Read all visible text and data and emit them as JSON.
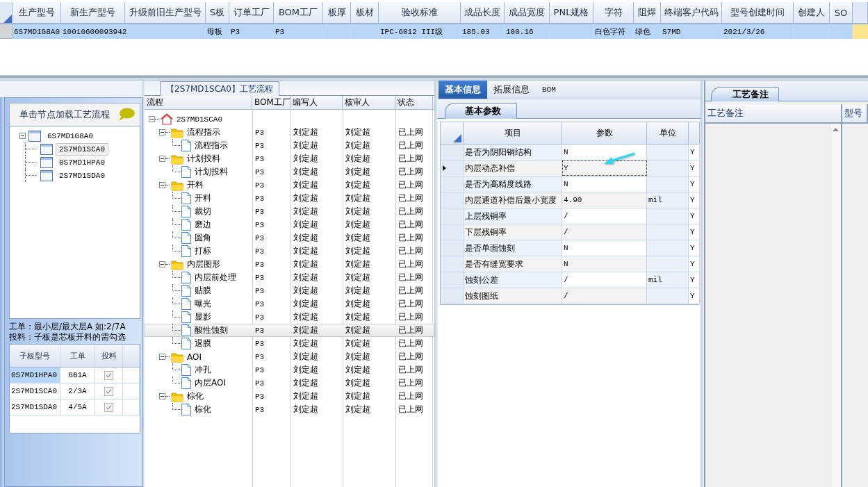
{
  "main_grid": {
    "row_selected": true,
    "columns": [
      {
        "header": "生产型号",
        "value": "6S7MD1G8A0"
      },
      {
        "header": "新生产型号",
        "value": "10010600093942"
      },
      {
        "header": "升级前旧生产型号"
      },
      {
        "header": "S板",
        "value": "母板"
      },
      {
        "header": "订单工厂",
        "value": "P3"
      },
      {
        "header": "BOM工厂",
        "value": "P3"
      },
      {
        "header": "板厚"
      },
      {
        "header": "板材"
      },
      {
        "header": "验收标准",
        "value": "IPC-6012 III级"
      },
      {
        "header": "成品长度",
        "value": "185.03"
      },
      {
        "header": "成品宽度",
        "value": "100.16"
      },
      {
        "header": "PNL规格"
      },
      {
        "header": "字符",
        "value": "白色字符"
      },
      {
        "header": "阻焊",
        "value": "绿色"
      },
      {
        "header": "终端客户代码",
        "value": "S7MD"
      },
      {
        "header": "型号创建时间",
        "value": "2021/3/26"
      },
      {
        "header": "创建人"
      },
      {
        "header": "SO"
      }
    ]
  },
  "left_panel": {
    "header": "单击节点加载工艺流程",
    "tree": [
      {
        "label": "6S7MD1G8A0",
        "expanded": true,
        "selected": false,
        "children": [
          {
            "label": "2S7MD1SCA0",
            "selected": true
          },
          {
            "label": "0S7MD1HPA0",
            "selected": false
          },
          {
            "label": "2S7MD1SDA0",
            "selected": false
          }
        ]
      }
    ],
    "notes": [
      "工单：最小层/最大层A 如:2/7A",
      "投料：子板是芯板开料的需勾选"
    ],
    "sub_grid": {
      "columns": [
        "子板型号",
        "工单",
        "投料"
      ],
      "rows": [
        {
          "model": "0S7MD1HPA0",
          "order": "GB1A",
          "feed": true,
          "selected": true
        },
        {
          "model": "2S7MD1SCA0",
          "order": "2/3A",
          "feed": true,
          "selected": false
        },
        {
          "model": "2S7MD1SDA0",
          "order": "4/5A",
          "feed": true,
          "selected": false
        }
      ]
    }
  },
  "process": {
    "title": "【2S7MD1SCA0】工艺流程",
    "columns": [
      "流程",
      "BOM工厂",
      "编写人",
      "核审人",
      "状态"
    ],
    "tree": {
      "label": "2S7MD1SCA0",
      "kind": "root",
      "expanded": true,
      "selected": false,
      "children": [
        {
          "label": "流程指示",
          "kind": "folder",
          "expanded": true,
          "selected": false,
          "factory": "P3",
          "writer": "刘定超",
          "reviewer": "刘定超",
          "status": "已上网",
          "children": [
            {
              "label": "流程指示",
              "kind": "step",
              "selected": false,
              "factory": "P3",
              "writer": "刘定超",
              "reviewer": "刘定超",
              "status": "已上网"
            }
          ]
        },
        {
          "label": "计划投料",
          "kind": "folder",
          "expanded": true,
          "selected": false,
          "factory": "P3",
          "writer": "刘定超",
          "reviewer": "刘定超",
          "status": "已上网",
          "children": [
            {
              "label": "计划投料",
              "kind": "step",
              "selected": false,
              "factory": "P3",
              "writer": "刘定超",
              "reviewer": "刘定超",
              "status": "已上网"
            }
          ]
        },
        {
          "label": "开料",
          "kind": "folder",
          "expanded": true,
          "selected": false,
          "factory": "P3",
          "writer": "刘定超",
          "reviewer": "刘定超",
          "status": "已上网",
          "children": [
            {
              "label": "开料",
              "kind": "step",
              "selected": false,
              "factory": "P3",
              "writer": "刘定超",
              "reviewer": "刘定超",
              "status": "已上网"
            },
            {
              "label": "裁切",
              "kind": "step",
              "selected": false,
              "factory": "P3",
              "writer": "刘定超",
              "reviewer": "刘定超",
              "status": "已上网"
            },
            {
              "label": "磨边",
              "kind": "step",
              "selected": false,
              "factory": "P3",
              "writer": "刘定超",
              "reviewer": "刘定超",
              "status": "已上网"
            },
            {
              "label": "圆角",
              "kind": "step",
              "selected": false,
              "factory": "P3",
              "writer": "刘定超",
              "reviewer": "刘定超",
              "status": "已上网"
            },
            {
              "label": "打标",
              "kind": "step",
              "selected": false,
              "factory": "P3",
              "writer": "刘定超",
              "reviewer": "刘定超",
              "status": "已上网"
            }
          ]
        },
        {
          "label": "内层图形",
          "kind": "folder",
          "expanded": true,
          "selected": false,
          "factory": "P3",
          "writer": "刘定超",
          "reviewer": "刘定超",
          "status": "已上网",
          "children": [
            {
              "label": "内层前处理",
              "kind": "step",
              "selected": false,
              "factory": "P3",
              "writer": "刘定超",
              "reviewer": "刘定超",
              "status": "已上网"
            },
            {
              "label": "贴膜",
              "kind": "step",
              "selected": false,
              "factory": "P3",
              "writer": "刘定超",
              "reviewer": "刘定超",
              "status": "已上网"
            },
            {
              "label": "曝光",
              "kind": "step",
              "selected": false,
              "factory": "P3",
              "writer": "刘定超",
              "reviewer": "刘定超",
              "status": "已上网"
            },
            {
              "label": "显影",
              "kind": "step",
              "selected": false,
              "factory": "P3",
              "writer": "刘定超",
              "reviewer": "刘定超",
              "status": "已上网"
            },
            {
              "label": "酸性蚀刻",
              "kind": "step",
              "selected": true,
              "factory": "P3",
              "writer": "刘定超",
              "reviewer": "刘定超",
              "status": "已上网"
            },
            {
              "label": "退膜",
              "kind": "step",
              "selected": false,
              "factory": "P3",
              "writer": "刘定超",
              "reviewer": "刘定超",
              "status": "已上网"
            }
          ]
        },
        {
          "label": "AOI",
          "kind": "folder",
          "expanded": true,
          "selected": false,
          "factory": "P3",
          "writer": "刘定超",
          "reviewer": "刘定超",
          "status": "已上网",
          "children": [
            {
              "label": "冲孔",
              "kind": "step",
              "selected": false,
              "factory": "P3",
              "writer": "刘定超",
              "reviewer": "刘定超",
              "status": "已上网"
            },
            {
              "label": "内层AOI",
              "kind": "step",
              "selected": false,
              "factory": "P3",
              "writer": "刘定超",
              "reviewer": "刘定超",
              "status": "已上网"
            }
          ]
        },
        {
          "label": "棕化",
          "kind": "folder",
          "expanded": true,
          "selected": false,
          "factory": "P3",
          "writer": "刘定超",
          "reviewer": "刘定超",
          "status": "已上网",
          "children": [
            {
              "label": "棕化",
              "kind": "step",
              "selected": false,
              "factory": "P3",
              "writer": "刘定超",
              "reviewer": "刘定超",
              "status": "已上网"
            }
          ]
        }
      ]
    }
  },
  "detail": {
    "tabs": [
      {
        "label": "基本信息",
        "selected": true
      },
      {
        "label": "拓展信息",
        "selected": false
      },
      {
        "label": "BOM",
        "selected": false
      }
    ],
    "sub_tab": "基本参数",
    "columns": [
      "项目",
      "参数",
      "单位"
    ],
    "rows": [
      {
        "item": "是否为阴阳铜结构",
        "value": "N",
        "flag": "Y",
        "current": false
      },
      {
        "item": "内层动态补偿",
        "value": "Y",
        "flag": "Y",
        "current": true
      },
      {
        "item": "是否为高精度线路",
        "value": "N",
        "flag": "Y",
        "current": false
      },
      {
        "item": "内层通道补偿后最小宽度",
        "value": "4.90",
        "unit": "mil",
        "flag": "Y",
        "current": false
      },
      {
        "item": "上层残铜率",
        "value": "/",
        "flag": "Y",
        "current": false
      },
      {
        "item": "下层残铜率",
        "value": "/",
        "flag": "Y",
        "current": false
      },
      {
        "item": "是否单面蚀刻",
        "value": "N",
        "flag": "Y",
        "current": false
      },
      {
        "item": "是否有缝宽要求",
        "value": "N",
        "flag": "Y",
        "current": false
      },
      {
        "item": "蚀刻公差",
        "value": "/",
        "unit": "mil",
        "flag": "Y",
        "current": false
      },
      {
        "item": "蚀刻图纸",
        "value": "/",
        "flag": "Y",
        "current": false
      }
    ]
  },
  "notes_panel": {
    "tab": "工艺备注",
    "columns": [
      "工艺备注",
      "型号"
    ]
  }
}
